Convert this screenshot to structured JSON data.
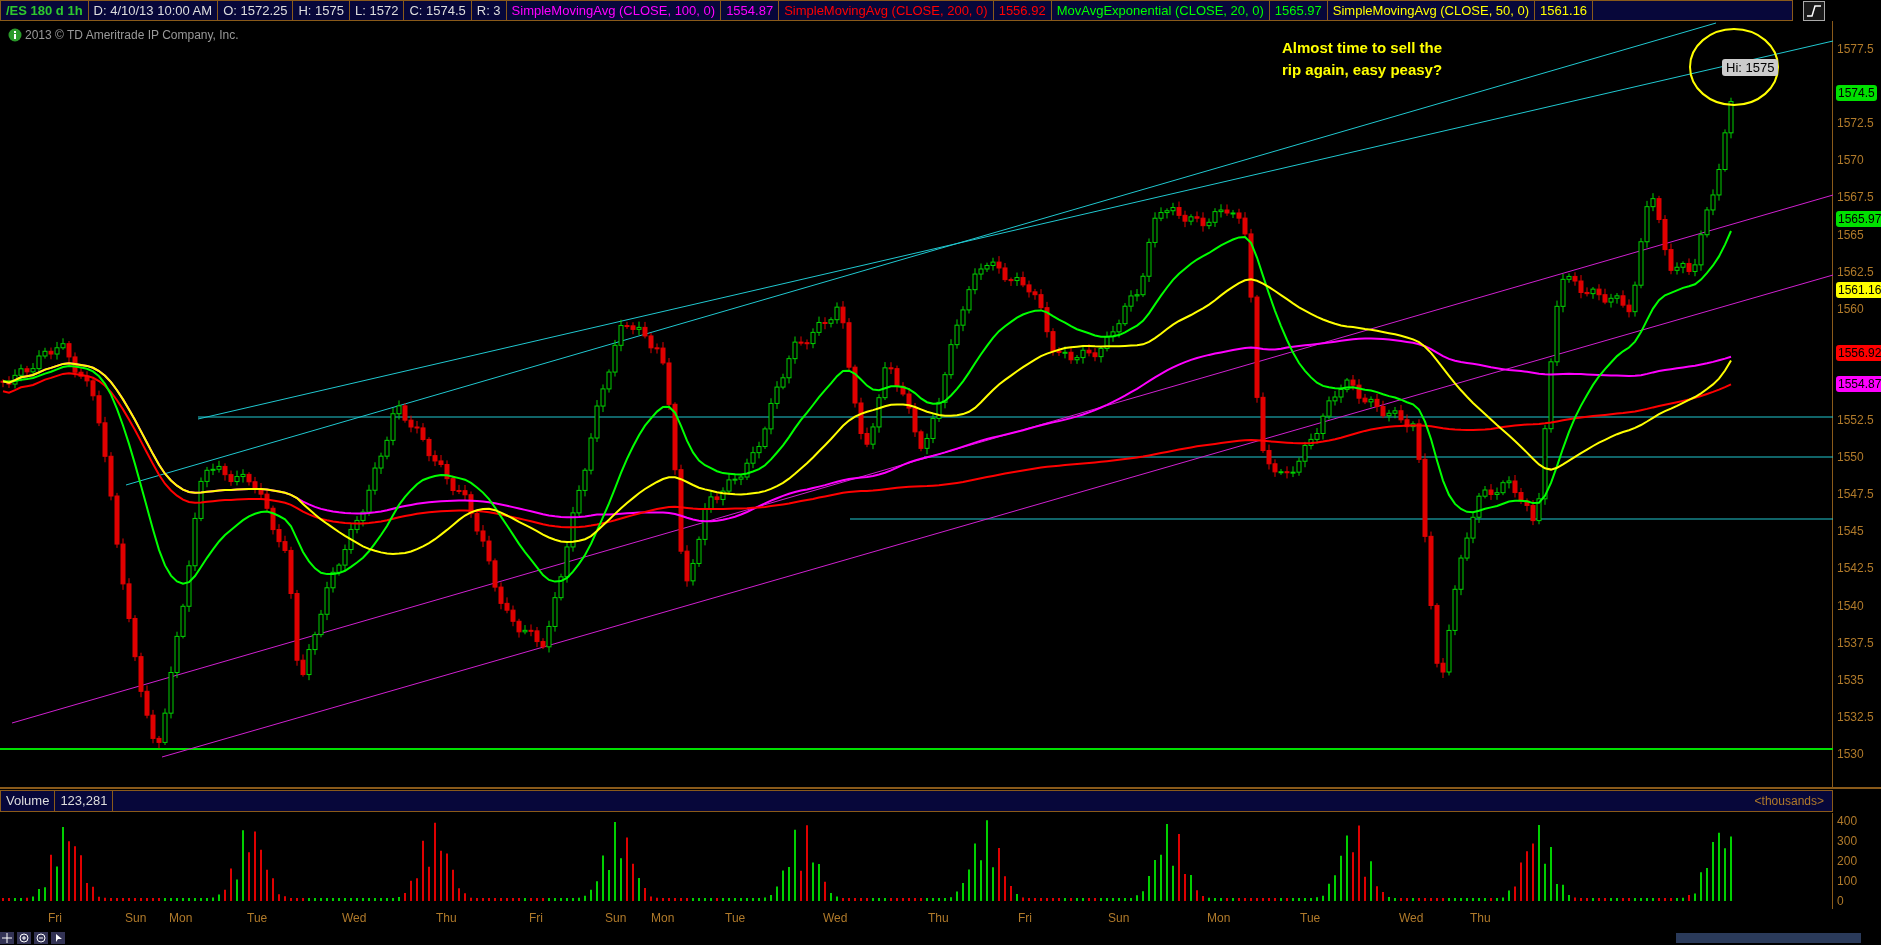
{
  "header": {
    "symbol": "/ES 180 d 1h",
    "quote": [
      "D: 4/10/13 10:00 AM",
      "O: 1572.25",
      "H: 1575",
      "L: 1572",
      "C: 1574.5",
      "R: 3"
    ],
    "studies": [
      {
        "name": "SimpleMovingAvg (CLOSE, 100, 0)",
        "value": "1554.87",
        "color": "#ff00ff"
      },
      {
        "name": "SimpleMovingAvg (CLOSE, 200, 0)",
        "value": "1556.92",
        "color": "#ff0000"
      },
      {
        "name": "MovAvgExponential (CLOSE, 20, 0)",
        "value": "1565.97",
        "color": "#00ff00"
      },
      {
        "name": "SimpleMovingAvg (CLOSE, 50, 0)",
        "value": "1561.16",
        "color": "#ffff00"
      }
    ]
  },
  "copyright": "2013 © TD Ameritrade IP Company, Inc.",
  "annotation": "Almost time to sell the rip again, easy peasy?",
  "high_label": "Hi: 1575",
  "price_axis": {
    "ticks": [
      "1577.5",
      "1572.5",
      "1570",
      "1567.5",
      "1565",
      "1562.5",
      "1560",
      "1552.5",
      "1550",
      "1547.5",
      "1545",
      "1542.5",
      "1540",
      "1537.5",
      "1535",
      "1532.5",
      "1530"
    ],
    "badges": [
      {
        "value": "1574.5",
        "color": "#00e000"
      },
      {
        "value": "1565.97",
        "color": "#00e000"
      },
      {
        "value": "1561.16",
        "color": "#ffff00"
      },
      {
        "value": "1556.92",
        "color": "#ff0000"
      },
      {
        "value": "1554.87",
        "color": "#ff00ff"
      }
    ]
  },
  "volume": {
    "label": "Volume",
    "value": "123,281",
    "units": "<thousands>",
    "ticks": [
      "400",
      "300",
      "200",
      "100",
      "0"
    ]
  },
  "x_axis": [
    "Fri",
    "Sun",
    "Mon",
    "Tue",
    "Wed",
    "Thu",
    "Fri",
    "Sun",
    "Mon",
    "Tue",
    "Wed",
    "Thu",
    "Fri",
    "Sun",
    "Mon",
    "Tue",
    "Wed",
    "Thu"
  ]
}
